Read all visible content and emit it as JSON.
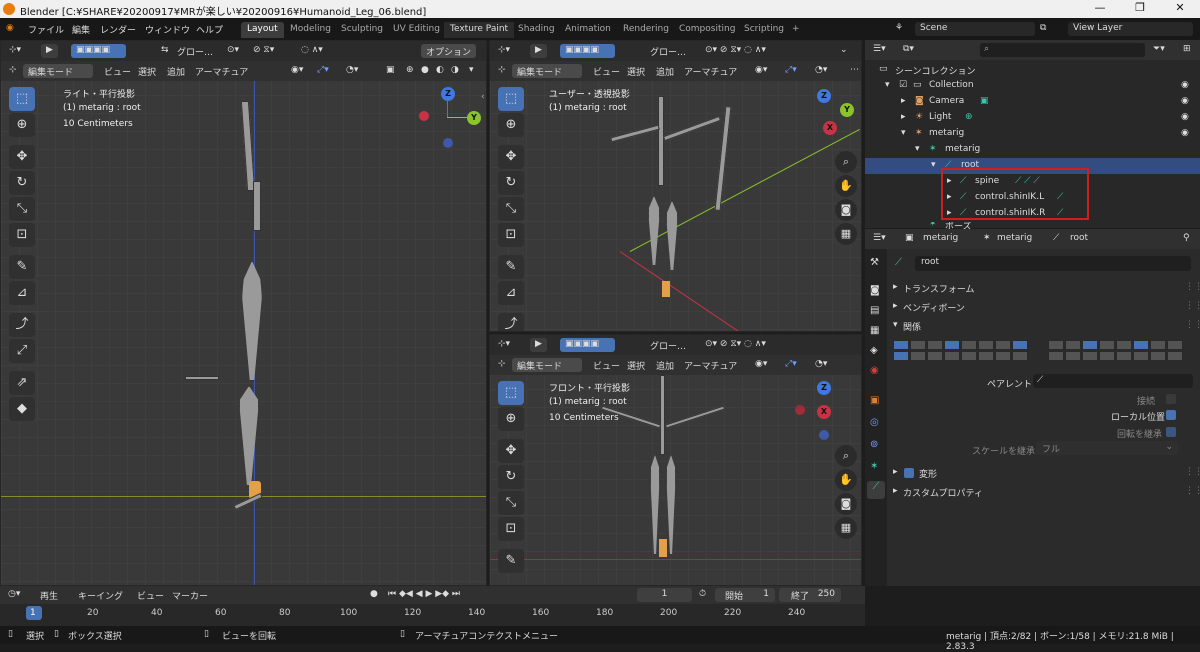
{
  "window": {
    "title": "Blender [C:¥SHARE¥20200917¥MRが楽しい¥20200916¥Humanoid_Leg_06.blend]",
    "minimize": "—",
    "maximize": "❐",
    "close": "✕"
  },
  "menus": [
    "ファイル",
    "編集",
    "レンダー",
    "ウィンドウ",
    "ヘルプ"
  ],
  "workspaces": [
    "Layout",
    "Modeling",
    "Sculpting",
    "UV Editing",
    "Texture Paint",
    "Shading",
    "Animation",
    "Rendering",
    "Compositing",
    "Scripting",
    "+"
  ],
  "scene": {
    "label": "Scene",
    "view_layer": "View Layer"
  },
  "viewport_header": {
    "global": "グロー…",
    "options": "オプション",
    "mode": "編集モード",
    "view": "ビュー",
    "select": "選択",
    "add": "追加",
    "armature": "アーマチュア"
  },
  "viewport_left": {
    "proj": "ライト・平行投影",
    "obj": "(1) metarig : root",
    "scale": "10 Centimeters"
  },
  "viewport_tr": {
    "proj": "ユーザー・透視投影",
    "obj": "(1) metarig : root"
  },
  "viewport_br": {
    "proj": "フロント・平行投影",
    "obj": "(1) metarig : root",
    "scale": "10 Centimeters",
    "global": "グロー…"
  },
  "gizmo": {
    "z": "Z",
    "y": "Y",
    "x": "X"
  },
  "outliner": {
    "root_label": "シーンコレクション",
    "items": [
      {
        "label": "Collection"
      },
      {
        "label": "Camera"
      },
      {
        "label": "Light"
      },
      {
        "label": "metarig"
      },
      {
        "label": "metarig"
      },
      {
        "label": "root"
      },
      {
        "label": "spine"
      },
      {
        "label": "control.shinIK.L"
      },
      {
        "label": "control.shinIK.R"
      },
      {
        "label": "ポーズ"
      }
    ]
  },
  "properties": {
    "breadcrumb": [
      "metarig",
      "metarig",
      "root"
    ],
    "bone_name": "root",
    "sections": [
      "トランスフォーム",
      "ベンディボーン",
      "関係",
      "変形",
      "カスタムプロパティ"
    ],
    "parent_label": "ペアレント",
    "connect_label": "接続",
    "local_location_label": "ローカル位置",
    "inherit_rotation_label": "回転を継承",
    "inherit_scale_label": "スケールを継承",
    "inherit_scale_value": "フル"
  },
  "timeline": {
    "playback": "再生",
    "keying": "キーイング",
    "view": "ビュー",
    "marker": "マーカー",
    "frame": "1",
    "start_label": "開始",
    "start": "1",
    "end_label": "終了",
    "end": "250"
  },
  "timeline_ticks": [
    "1",
    "20",
    "40",
    "60",
    "80",
    "100",
    "120",
    "140",
    "160",
    "180",
    "200",
    "220",
    "240"
  ],
  "status": {
    "select": "選択",
    "box_select": "ボックス選択",
    "rotate_view": "ビューを回転",
    "context_menu": "アーマチュアコンテクストメニュー",
    "info": "metarig | 頂点:2/82 | ボーン:1/58 | メモリ:21.8 MiB | 2.83.3"
  },
  "colors": {
    "accent": "#4772b3",
    "highlight": "#cc1f1f",
    "bone_green": "#3bc7a8"
  }
}
